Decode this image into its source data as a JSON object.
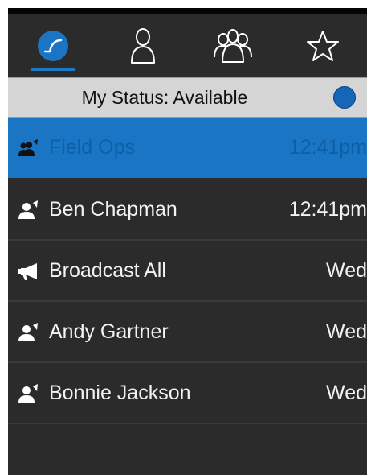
{
  "tabs": [
    {
      "name": "recent",
      "icon": "recent-calls-icon",
      "active": true
    },
    {
      "name": "contact",
      "icon": "person-icon",
      "active": false
    },
    {
      "name": "groups",
      "icon": "group-icon",
      "active": false
    },
    {
      "name": "favorites",
      "icon": "star-icon",
      "active": false
    }
  ],
  "status": {
    "label": "My Status: Available",
    "indicator_color": "#1565b8"
  },
  "conversations": [
    {
      "label": "Field Ops",
      "time": "12:41pm",
      "icon": "group-talk-icon",
      "selected": true
    },
    {
      "label": "Ben Chapman",
      "time": "12:41pm",
      "icon": "private-talk-icon",
      "selected": false
    },
    {
      "label": "Broadcast All",
      "time": "Wed",
      "icon": "megaphone-icon",
      "selected": false
    },
    {
      "label": "Andy Gartner",
      "time": "Wed",
      "icon": "private-talk-icon",
      "selected": false
    },
    {
      "label": "Bonnie Jackson",
      "time": "Wed",
      "icon": "private-talk-icon",
      "selected": false
    }
  ],
  "colors": {
    "accent": "#1a76c4",
    "background": "#2b2b2b",
    "status_bar": "#d5d5d5"
  }
}
